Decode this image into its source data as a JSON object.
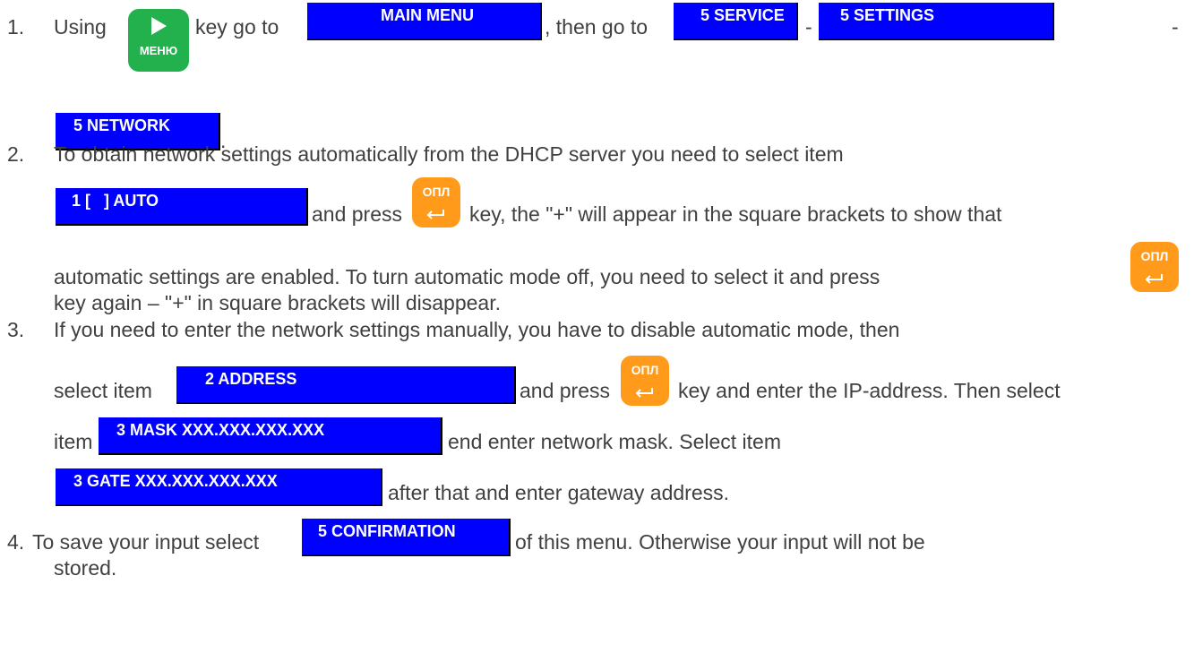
{
  "colors": {
    "menu_box": "#0000ff",
    "menu_key": "#22b14c",
    "enter_key": "#ff9a1a",
    "text": "#404040"
  },
  "keys": {
    "menu_label": "МЕНЮ",
    "enter_label": "ОПЛ",
    "menu_icon": "play-triangle-icon",
    "enter_icon": "enter-arrow-icon"
  },
  "step1": {
    "num": "1.",
    "t1": "Using",
    "t2": "key go to",
    "t3": ", then go to",
    "t4": "-",
    "t5": "-",
    "t6": ".",
    "box_main": "MAIN MENU",
    "box_service": "5 SERVICE",
    "box_settings": "5 SETTINGS",
    "box_network": "5 NETWORK"
  },
  "step2": {
    "num": "2.",
    "line1": "To obtain network settings automatically from the DHCP server you need to select item",
    "box_auto": "1 [   ] AUTO",
    "t1": "and press",
    "t2": "key, the \"+\" will appear in the square brackets to show that",
    "line3": "automatic settings are enabled. To turn automatic mode off, you need to select it and press",
    "line4": "key again – \"+\" in square brackets will disappear."
  },
  "step3": {
    "num": "3.",
    "line1": "If you need to enter the network settings manually, you have to disable automatic mode, then",
    "t1": "select item",
    "box_address": "2 ADDRESS",
    "t2": "and press",
    "t3": "key and enter the IP-address. Then select",
    "t4": "item",
    "box_mask": "3 MASK XXX.XXX.XXX.XXX",
    "t5": "end enter network mask. Select item",
    "box_gate": "3 GATE XXX.XXX.XXX.XXX",
    "t6": "after that and enter gateway address."
  },
  "step4": {
    "num": "4.",
    "t1": "To save your input select",
    "box_confirm": "5 CONFIRMATION",
    "t2": "of this menu. Otherwise your input will not be",
    "t3": "stored."
  }
}
